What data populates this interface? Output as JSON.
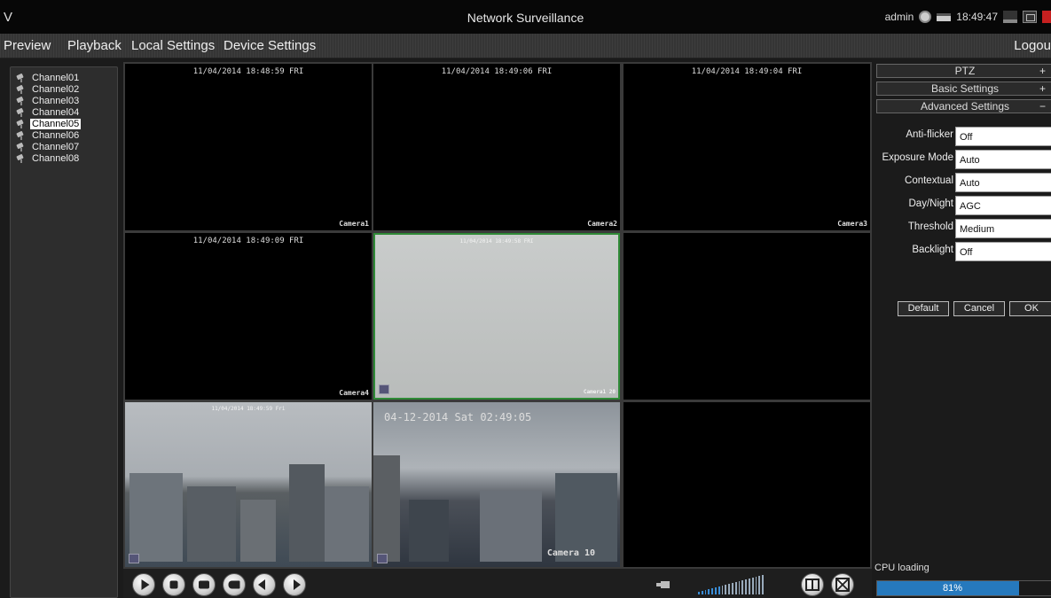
{
  "app": {
    "logo": "V",
    "title": "Network Surveillance",
    "user": "admin",
    "clock": "18:49:47"
  },
  "menu": {
    "preview": "Preview",
    "playback": "Playback",
    "local_settings": "Local Settings",
    "device_settings": "Device Settings",
    "logout": "Logou"
  },
  "channels": [
    "Channel01",
    "Channel02",
    "Channel03",
    "Channel04",
    "Channel05",
    "Channel06",
    "Channel07",
    "Channel08"
  ],
  "selected_channel": "Channel05",
  "cells": [
    {
      "timestamp": "11/04/2014 18:48:59 FRI",
      "camera": "Camera1"
    },
    {
      "timestamp": "11/04/2014 18:49:06 FRI",
      "camera": "Camera2"
    },
    {
      "timestamp": "11/04/2014 18:49:04 FRI",
      "camera": "Camera3"
    },
    {
      "timestamp": "11/04/2014 18:49:09 FRI",
      "camera": "Camera4"
    },
    {
      "timestamp": "11/04/2014 18:49:58 FRI",
      "camera": "Camera1 20"
    },
    {
      "timestamp": "",
      "camera": ""
    },
    {
      "timestamp": "11/04/2014 18:49:59 Fri",
      "camera": ""
    },
    {
      "timestamp": "04-12-2014 Sat 02:49:05",
      "camera": "Camera 10"
    },
    {
      "timestamp": "",
      "camera": ""
    }
  ],
  "panel": {
    "ptz": {
      "label": "PTZ",
      "sign": "+"
    },
    "basic": {
      "label": "Basic Settings",
      "sign": "+"
    },
    "advanced": {
      "label": "Advanced Settings",
      "sign": "−"
    },
    "fields": [
      {
        "label": "Anti-flicker",
        "value": "Off"
      },
      {
        "label": "Exposure Mode",
        "value": "Auto"
      },
      {
        "label": "Contextual",
        "value": "Auto"
      },
      {
        "label": "Day/Night",
        "value": "AGC"
      },
      {
        "label": "Threshold",
        "value": "Medium"
      },
      {
        "label": "Backlight",
        "value": "Off"
      }
    ],
    "buttons": {
      "default": "Default",
      "cancel": "Cancel",
      "ok": "OK"
    },
    "cpu_label": "CPU loading",
    "cpu_value": "81%",
    "cpu_fraction": 0.81
  },
  "volume_level": 0.35,
  "icons": [
    "globe-icon",
    "keyboard-icon",
    "minimize-icon",
    "restore-icon",
    "close-icon",
    "camera-icon",
    "play-icon",
    "stop-icon",
    "snapshot-icon",
    "record-icon",
    "prev-icon",
    "next-icon",
    "volume-icon",
    "layout-icon",
    "fullscreen-icon"
  ]
}
